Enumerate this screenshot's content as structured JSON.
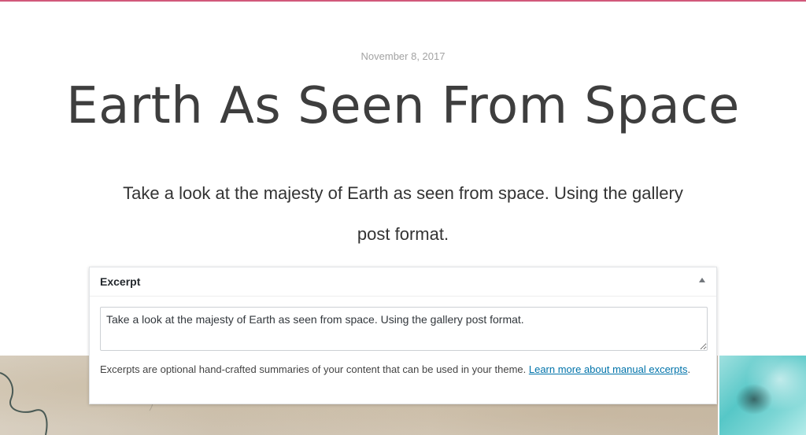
{
  "post": {
    "date": "November 8, 2017",
    "title": "Earth As Seen From Space",
    "excerpt": "Take a look at the majesty of Earth as seen from space. Using the gallery post format."
  },
  "metabox": {
    "title": "Excerpt",
    "textarea_value": "Take a look at the majesty of Earth as seen from space. Using the gallery post format.",
    "help_text": "Excerpts are optional hand-crafted summaries of your content that can be used in your theme. ",
    "help_link": "Learn more about manual excerpts",
    "help_suffix": ".",
    "toggle_icon": "triangle-up-icon"
  },
  "colors": {
    "accent": "#d1587a",
    "link": "#0073aa",
    "title": "#3e3e3e"
  }
}
